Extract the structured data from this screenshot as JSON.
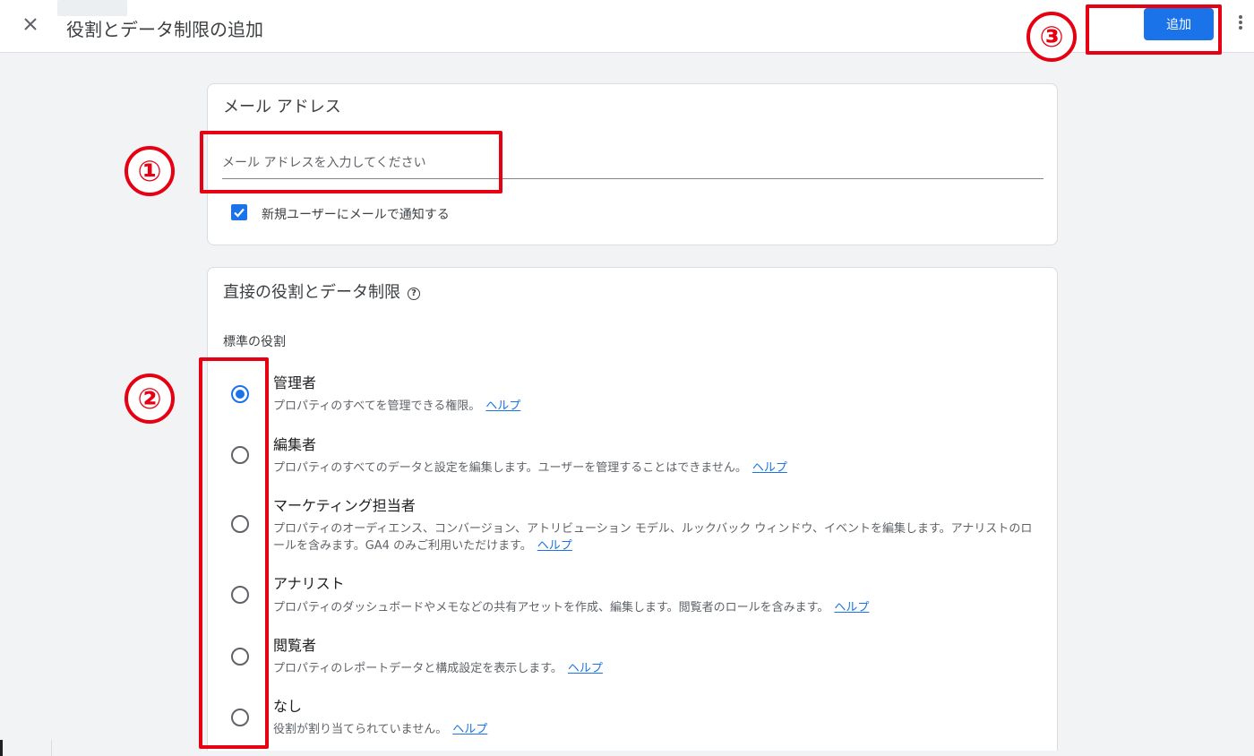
{
  "header": {
    "title": "役割とデータ制限の追加",
    "add_button": "追加",
    "close_icon": "close-icon",
    "more_icon": "more-vert-icon"
  },
  "email_card": {
    "title": "メール アドレス",
    "email_placeholder": "メール アドレスを入力してください",
    "email_value": "",
    "notify_label": "新規ユーザーにメールで通知する",
    "notify_checked": true
  },
  "roles_card": {
    "title": "直接の役割とデータ制限",
    "section_label": "標準の役割",
    "roles": [
      {
        "name": "管理者",
        "desc": "プロパティのすべてを管理できる権限。",
        "help": "ヘルプ",
        "selected": true
      },
      {
        "name": "編集者",
        "desc": "プロパティのすべてのデータと設定を編集します。ユーザーを管理することはできません。",
        "help": "ヘルプ",
        "selected": false
      },
      {
        "name": "マーケティング担当者",
        "desc": "プロパティのオーディエンス、コンバージョン、アトリビューション モデル、ルックバック ウィンドウ、イベントを編集します。アナリストのロールを含みます。GA4 のみご利用いただけます。",
        "help": "ヘルプ",
        "selected": false
      },
      {
        "name": "アナリスト",
        "desc": "プロパティのダッシュボードやメモなどの共有アセットを作成、編集します。閲覧者のロールを含みます。",
        "help": "ヘルプ",
        "selected": false
      },
      {
        "name": "閲覧者",
        "desc": "プロパティのレポートデータと構成設定を表示します。",
        "help": "ヘルプ",
        "selected": false
      },
      {
        "name": "なし",
        "desc": "役割が割り当てられていません。",
        "help": "ヘルプ",
        "selected": false
      }
    ]
  },
  "annotations": {
    "marker_1": "①",
    "marker_2": "②",
    "marker_3": "③",
    "color": "#e60012"
  },
  "colors": {
    "accent": "#1a73e8",
    "background": "#f1f3f4"
  }
}
